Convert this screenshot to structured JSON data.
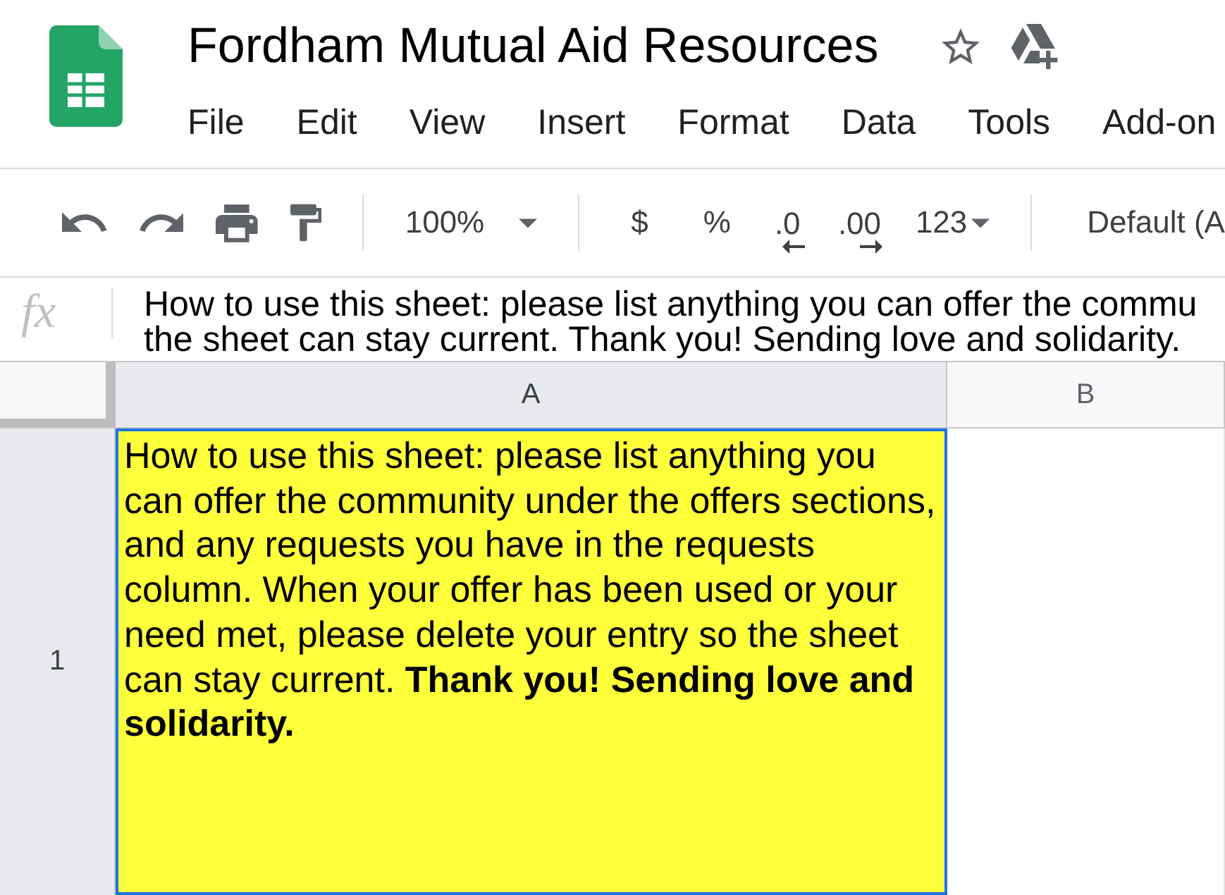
{
  "document": {
    "title": "Fordham Mutual Aid Resources"
  },
  "menu": [
    "File",
    "Edit",
    "View",
    "Insert",
    "Format",
    "Data",
    "Tools",
    "Add-on"
  ],
  "toolbar": {
    "zoom": "100%",
    "currency": "$",
    "percent": "%",
    "decrease_decimals": ".0",
    "increase_decimals": ".00",
    "number_format": "123",
    "font": "Default (A"
  },
  "formula_bar": {
    "label": "fx",
    "lines": [
      "How to use this sheet: please list anything you can offer the commu",
      "the sheet can stay current. Thank you! Sending love and solidarity."
    ]
  },
  "grid": {
    "columns": [
      {
        "label": "A",
        "selected": true
      },
      {
        "label": "B",
        "selected": false
      }
    ],
    "rows": [
      {
        "label": "1",
        "selected": true,
        "cells": [
          {
            "text": "How to use this sheet: please list anything you can offer the community under the offers sections, and any requests you have in the requests column. When your offer has been used or your need met, please delete your entry so the sheet can stay current. **Thank you! Sending love and solidarity.**",
            "color": "#ffff3b",
            "selected": true
          },
          {
            "selected": false
          }
        ]
      }
    ]
  }
}
